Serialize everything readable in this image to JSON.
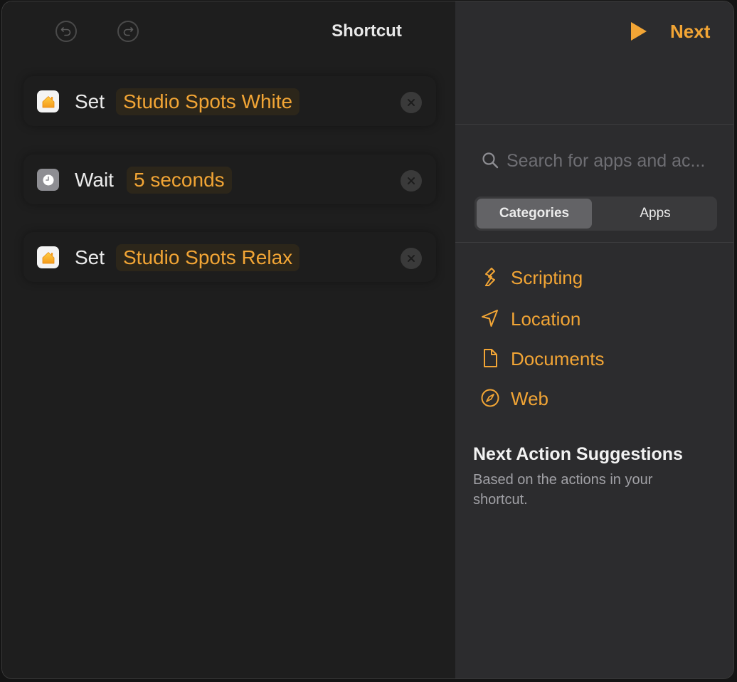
{
  "editor": {
    "title": "Shortcut",
    "undo_icon": "undo-arrow-icon",
    "redo_icon": "redo-arrow-icon",
    "actions": [
      {
        "icon": "home-app-icon",
        "verb": "Set",
        "parameter": "Studio Spots White"
      },
      {
        "icon": "clock-icon",
        "verb": "Wait",
        "parameter": "5 seconds"
      },
      {
        "icon": "home-app-icon",
        "verb": "Set",
        "parameter": "Studio Spots Relax"
      }
    ]
  },
  "library": {
    "run_icon": "play-icon",
    "next_label": "Next",
    "search_placeholder": "Search for apps and ac...",
    "segments": [
      "Categories",
      "Apps"
    ],
    "selected_segment": "Categories",
    "categories": [
      {
        "icon": "scripting-icon",
        "label": "Scripting"
      },
      {
        "icon": "location-arrow-icon",
        "label": "Location"
      },
      {
        "icon": "document-icon",
        "label": "Documents"
      },
      {
        "icon": "compass-icon",
        "label": "Web"
      }
    ],
    "suggestions": {
      "title": "Next Action Suggestions",
      "subtitle": "Based on the actions in your shortcut."
    }
  },
  "colors": {
    "accent": "#f2a535",
    "editor_bg": "#1e1e1e",
    "library_bg": "#2c2c2e"
  }
}
